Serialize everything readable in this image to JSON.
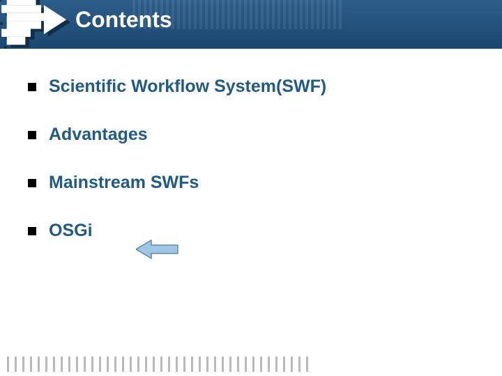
{
  "header": {
    "title": "Contents"
  },
  "content": {
    "items": [
      {
        "label": "Scientific Workflow System(SWF)"
      },
      {
        "label": "Advantages"
      },
      {
        "label": "Mainstream SWFs"
      },
      {
        "label": "OSGi"
      }
    ]
  },
  "colors": {
    "header_bg_top": "#2d5d8a",
    "header_bg_bottom": "#1a4770",
    "item_text": "#205a86",
    "arrow_fill": "#9fc6e4",
    "arrow_stroke": "#5b8bb5"
  }
}
